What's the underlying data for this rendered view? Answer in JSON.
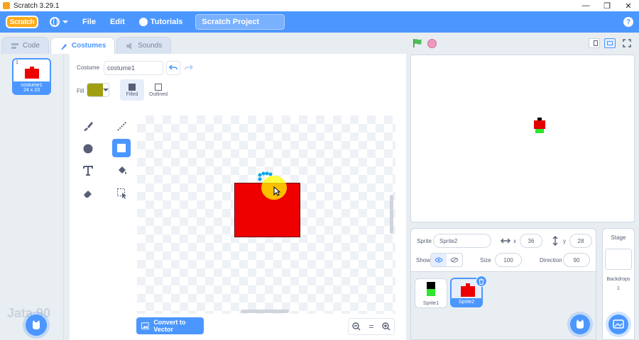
{
  "window": {
    "title": "Scratch 3.29.1",
    "controls": {
      "minimize": "—",
      "restore": "❐",
      "close": "✕"
    }
  },
  "menubar": {
    "logo": "Scratch",
    "file": "File",
    "edit": "Edit",
    "tutorials": "Tutorials",
    "project_title": "Scratch Project",
    "help_icon": "?"
  },
  "tabs": [
    {
      "label": "Code",
      "icon": "code-icon",
      "active": false
    },
    {
      "label": "Costumes",
      "icon": "brush-icon",
      "active": true
    },
    {
      "label": "Sounds",
      "icon": "speaker-icon",
      "active": false
    }
  ],
  "costume_list": {
    "items": [
      {
        "number": "1",
        "name": "costume1",
        "size": "24 x 23",
        "selected": true
      }
    ],
    "watermark": "Jata 90"
  },
  "paint_editor": {
    "costume_label": "Costume",
    "costume_name": "costume1",
    "fill_label": "Fill",
    "fill_color": "#9f9f11",
    "modes": [
      {
        "label": "Filled",
        "active": true
      },
      {
        "label": "Outlined",
        "active": false
      }
    ],
    "tools": [
      "brush",
      "line",
      "circle",
      "rectangle",
      "text",
      "fill",
      "eraser",
      "select"
    ],
    "active_tool": "rectangle",
    "convert_button": "Convert to Vector",
    "zoom": {
      "out": "−",
      "reset": "=",
      "in": "+"
    },
    "shape_color": "#ef0000"
  },
  "stage_controls": {
    "green_flag_color": "#4cbf56",
    "stop_color": "#ec9bbf"
  },
  "sprite_info": {
    "sprite_label": "Sprite",
    "sprite_name": "Sprite2",
    "x_label": "x",
    "x_value": "36",
    "y_label": "y",
    "y_value": "28",
    "show_label": "Show",
    "size_label": "Size",
    "size_value": "100",
    "direction_label": "Direction",
    "direction_value": "90"
  },
  "sprites": [
    {
      "name": "Sprite1",
      "selected": false
    },
    {
      "name": "Sprite2",
      "selected": true
    }
  ],
  "stage_panel": {
    "title": "Stage",
    "backdrops_label": "Backdrops",
    "backdrops_count": "1"
  },
  "colors": {
    "accent": "#4c97ff",
    "brand": "#ffab19"
  }
}
